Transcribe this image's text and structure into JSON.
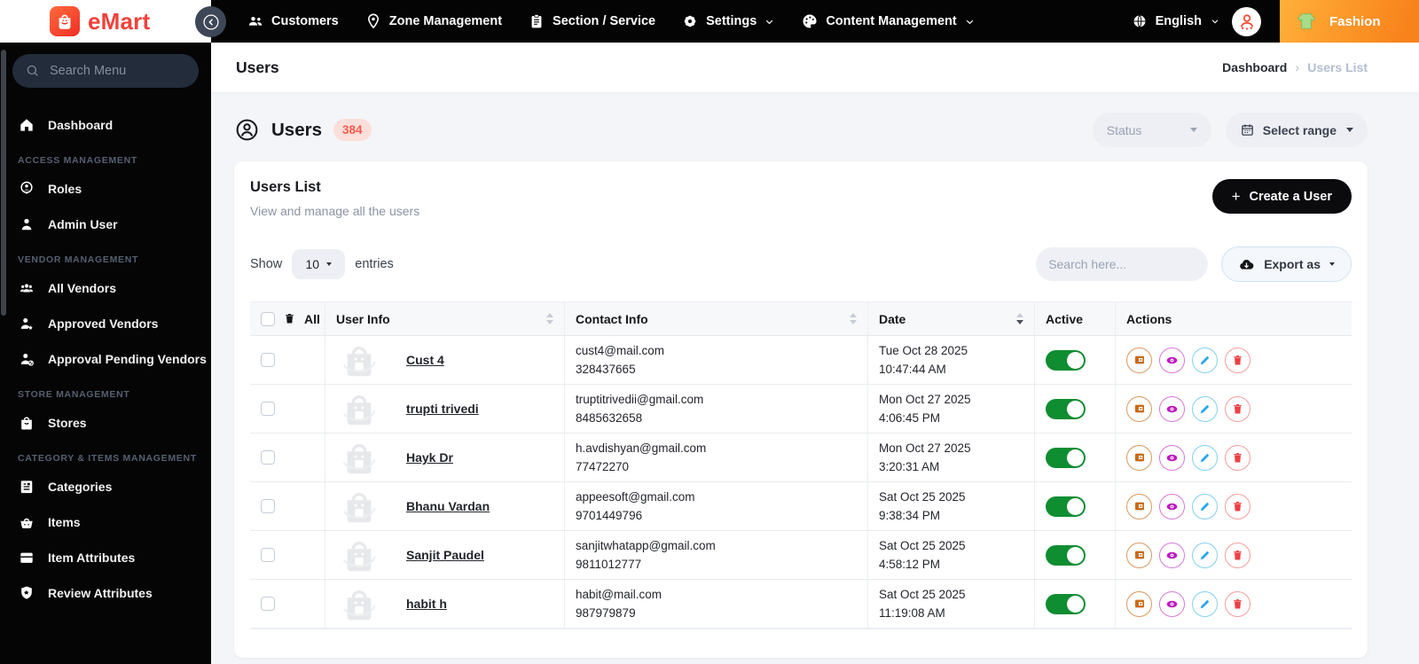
{
  "navbar": {
    "brand": "eMart",
    "items": [
      {
        "label": "Customers",
        "icon": "customers-icon"
      },
      {
        "label": "Zone Management",
        "icon": "zone-icon"
      },
      {
        "label": "Section / Service",
        "icon": "section-icon"
      },
      {
        "label": "Settings",
        "icon": "settings-icon",
        "has_caret": true
      },
      {
        "label": "Content Management",
        "icon": "content-icon",
        "has_caret": true
      }
    ],
    "language": "English",
    "store": "Fashion"
  },
  "sidebar": {
    "search_placeholder": "Search Menu",
    "dashboard_label": "Dashboard",
    "sections": [
      {
        "label": "ACCESS MANAGEMENT",
        "items": [
          {
            "label": "Roles"
          },
          {
            "label": "Admin User"
          }
        ]
      },
      {
        "label": "VENDOR MANAGEMENT",
        "items": [
          {
            "label": "All Vendors"
          },
          {
            "label": "Approved Vendors"
          },
          {
            "label": "Approval Pending Vendors"
          }
        ]
      },
      {
        "label": "STORE MANAGEMENT",
        "items": [
          {
            "label": "Stores"
          }
        ]
      },
      {
        "label": "CATEGORY & ITEMS MANAGEMENT",
        "items": [
          {
            "label": "Categories"
          },
          {
            "label": "Items"
          },
          {
            "label": "Item Attributes"
          },
          {
            "label": "Review Attributes"
          }
        ]
      }
    ]
  },
  "page": {
    "title": "Users",
    "breadcrumb": {
      "parent": "Dashboard",
      "separator": "›",
      "current": "Users List"
    },
    "heading": "Users",
    "count": "384",
    "status_filter": "Status",
    "range_filter": "Select range"
  },
  "card": {
    "title": "Users List",
    "subtitle": "View and manage all the users",
    "create_button": "Create a User",
    "show_label": "Show",
    "page_size": "10",
    "entries_label": "entries",
    "search_placeholder": "Search here...",
    "export_label": "Export as"
  },
  "table": {
    "select_all": "All",
    "columns": [
      "User Info",
      "Contact Info",
      "Date",
      "Active",
      "Actions"
    ],
    "rows": [
      {
        "name": "Cust 4",
        "email": "cust4@mail.com",
        "phone": "328437665",
        "date": "Tue Oct 28 2025",
        "time": "10:47:44 AM",
        "active": true
      },
      {
        "name": "trupti trivedi",
        "email": "truptitrivedii@gmail.com",
        "phone": "8485632658",
        "date": "Mon Oct 27 2025",
        "time": "4:06:45 PM",
        "active": true
      },
      {
        "name": "Hayk Dr",
        "email": "h.avdishyan@gmail.com",
        "phone": "77472270",
        "date": "Mon Oct 27 2025",
        "time": "3:20:31 AM",
        "active": true
      },
      {
        "name": "Bhanu Vardan",
        "email": "appeesoft@gmail.com",
        "phone": "9701449796",
        "date": "Sat Oct 25 2025",
        "time": "9:38:34 PM",
        "active": true
      },
      {
        "name": "Sanjit Paudel",
        "email": "sanjitwhatapp@gmail.com",
        "phone": "9811012777",
        "date": "Sat Oct 25 2025",
        "time": "4:58:12 PM",
        "active": true
      },
      {
        "name": "habit h",
        "email": "habit@mail.com",
        "phone": "987979879",
        "date": "Sat Oct 25 2025",
        "time": "11:19:08 AM",
        "active": true
      }
    ]
  },
  "colors": {
    "accent_red": "#f2413a",
    "badge_bg": "#fcdfda",
    "badge_text": "#f25a4d",
    "toggle_green": "#0f8d31",
    "action_manage": "#c96b16",
    "action_view": "#bb1dbe",
    "action_edit": "#2ba7e9",
    "action_delete": "#ee3e45",
    "topbar_bg": "#040405",
    "store_gradient": "#f8821b"
  }
}
